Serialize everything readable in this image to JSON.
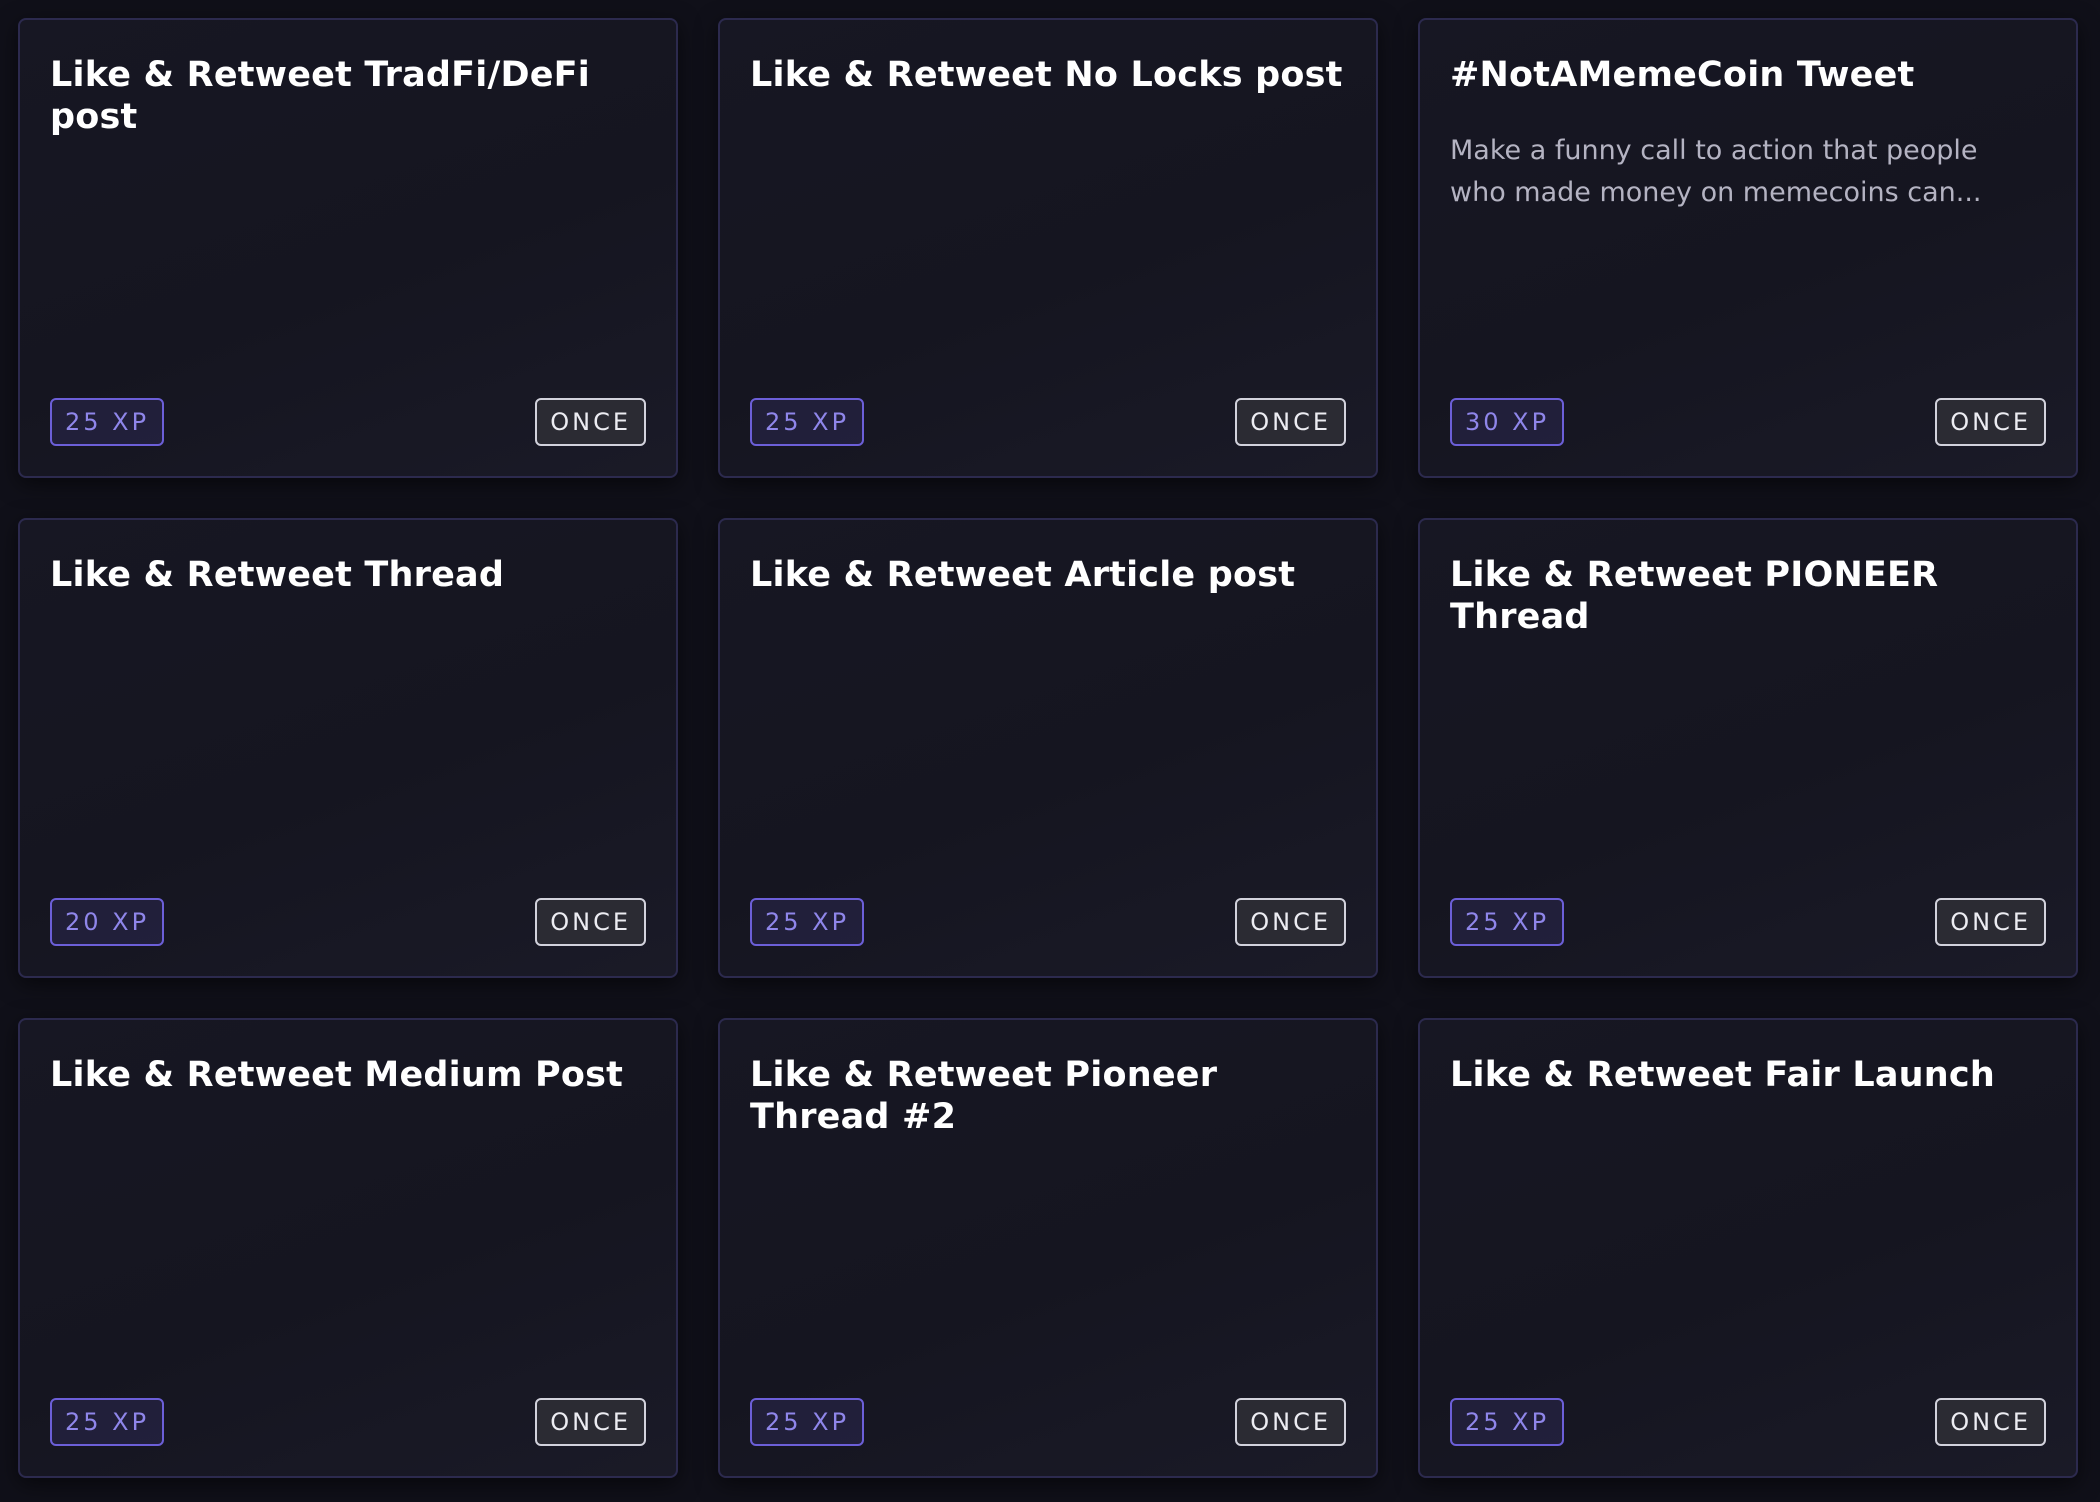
{
  "quests": [
    {
      "title": "Like & Retweet TradFi/DeFi post",
      "description": "",
      "xp": "25 XP",
      "frequency": "ONCE"
    },
    {
      "title": "Like & Retweet No Locks post",
      "description": "",
      "xp": "25 XP",
      "frequency": "ONCE"
    },
    {
      "title": "#NotAMemeCoin Tweet",
      "description": "Make a funny call to action that people who made money on memecoins can...",
      "xp": "30 XP",
      "frequency": "ONCE"
    },
    {
      "title": "Like & Retweet Thread",
      "description": "",
      "xp": "20 XP",
      "frequency": "ONCE"
    },
    {
      "title": "Like & Retweet Article post",
      "description": "",
      "xp": "25 XP",
      "frequency": "ONCE"
    },
    {
      "title": "Like & Retweet PIONEER Thread",
      "description": "",
      "xp": "25 XP",
      "frequency": "ONCE"
    },
    {
      "title": "Like & Retweet Medium Post",
      "description": "",
      "xp": "25 XP",
      "frequency": "ONCE"
    },
    {
      "title": "Like & Retweet Pioneer Thread #2",
      "description": "",
      "xp": "25 XP",
      "frequency": "ONCE"
    },
    {
      "title": "Like & Retweet Fair Launch",
      "description": "",
      "xp": "25 XP",
      "frequency": "ONCE"
    }
  ]
}
